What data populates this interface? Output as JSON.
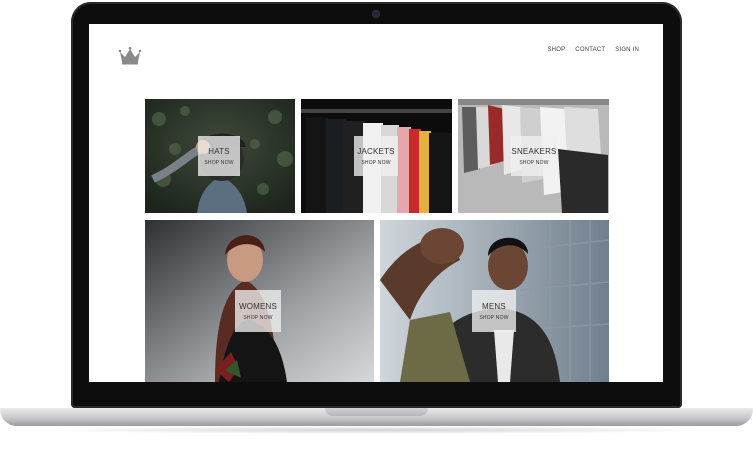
{
  "header": {
    "logo_icon": "crown-icon",
    "nav": [
      "SHOP",
      "CONTACT",
      "SIGN IN"
    ]
  },
  "categories": [
    {
      "title": "HATS",
      "cta": "SHOP NOW"
    },
    {
      "title": "JACKETS",
      "cta": "SHOP NOW"
    },
    {
      "title": "SNEAKERS",
      "cta": "SHOP NOW"
    },
    {
      "title": "WOMENS",
      "cta": "SHOP NOW"
    },
    {
      "title": "MENS",
      "cta": "SHOP NOW"
    }
  ],
  "colors": {
    "laptop_bezel": "#0d0d0d",
    "aluminum": "#c7c9cc",
    "label_box": "#f0f0f0"
  }
}
